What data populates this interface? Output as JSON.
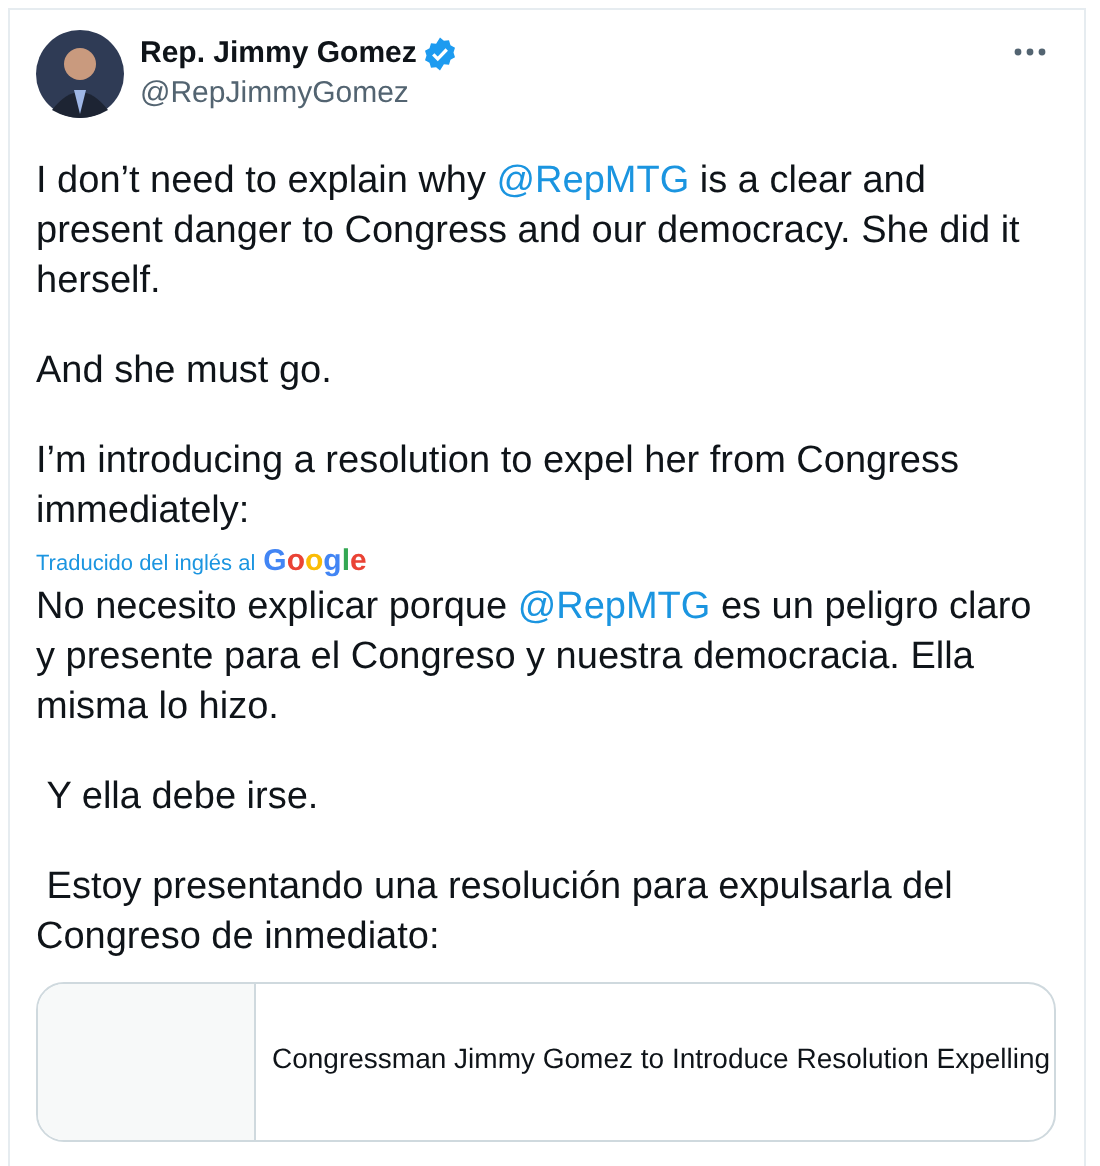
{
  "author": {
    "name": "Rep. Jimmy Gomez",
    "handle": "@RepJimmyGomez",
    "verified": true
  },
  "original_paragraphs": [
    [
      {
        "kind": "text",
        "text": "I don’t need to explain why "
      },
      {
        "kind": "mention",
        "text": "@RepMTG"
      },
      {
        "kind": "text",
        "text": " is a clear and present danger to Congress and our democracy. She did it herself."
      }
    ],
    [
      {
        "kind": "text",
        "text": "And she must go."
      }
    ],
    [
      {
        "kind": "text",
        "text": "I’m introducing a resolution to expel her from Congress immediately:"
      }
    ]
  ],
  "translation": {
    "label": "Traducido del inglés al",
    "provider": "Google"
  },
  "translated_paragraphs": [
    [
      {
        "kind": "text",
        "text": "No necesito explicar porque "
      },
      {
        "kind": "mention",
        "text": "@RepMTG"
      },
      {
        "kind": "text",
        "text": " es un peligro claro y presente para el Congreso y nuestra democracia. Ella misma lo hizo."
      }
    ],
    [
      {
        "kind": "text",
        "text": " Y ella debe irse."
      }
    ],
    [
      {
        "kind": "text",
        "text": " Estoy presentando una resolución para expulsarla del Congreso de inmediato:"
      }
    ]
  ],
  "link_card": {
    "title": "Congressman Jimmy Gomez to Introduce Resolution Expelling"
  }
}
